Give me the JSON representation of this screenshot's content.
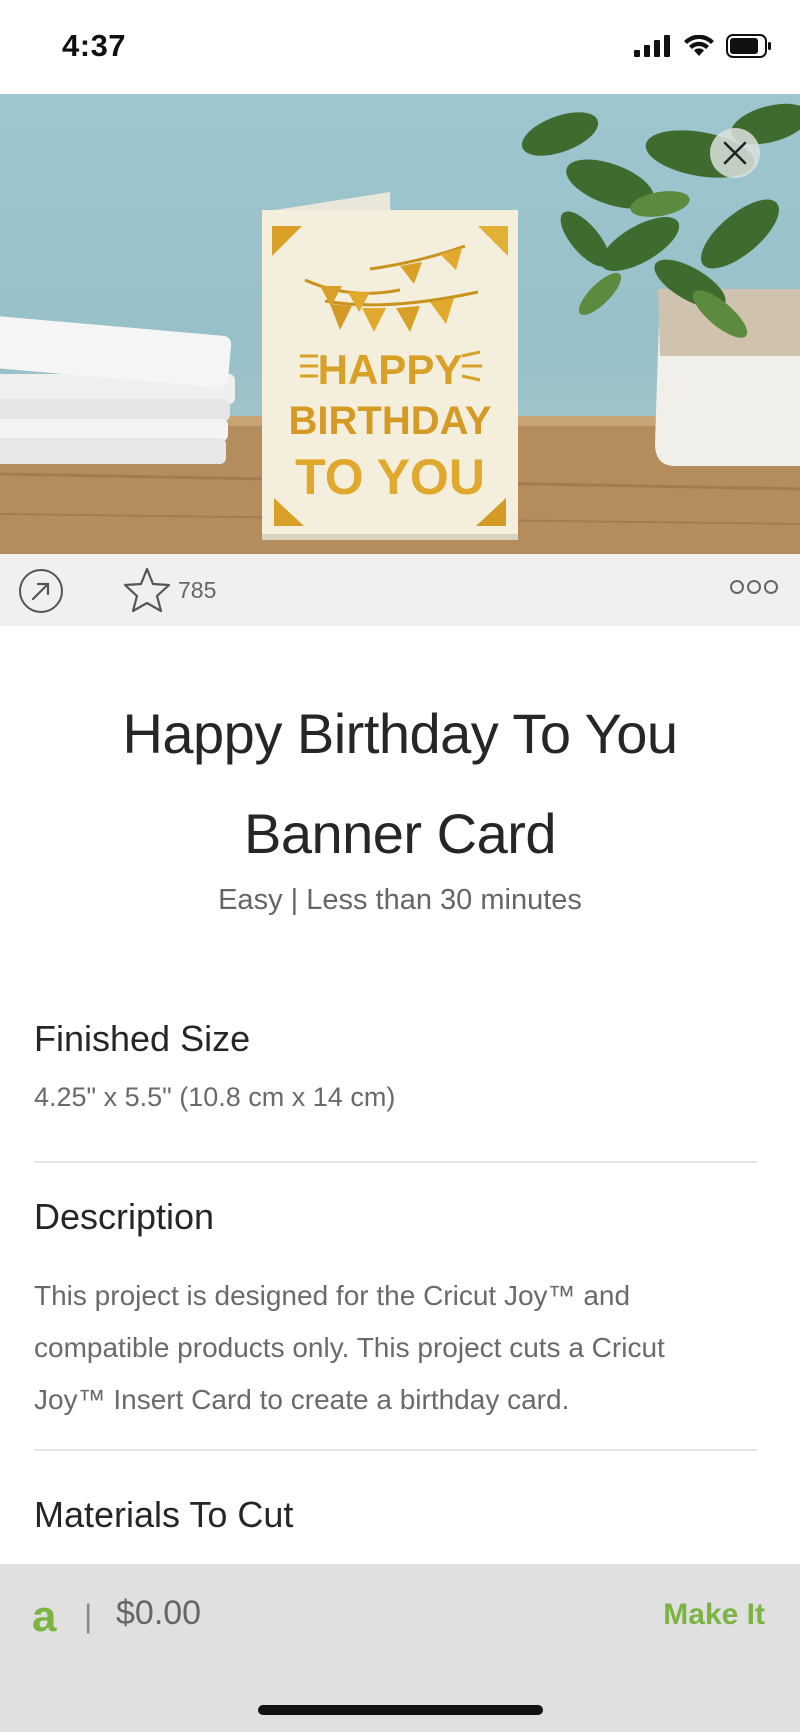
{
  "status": {
    "time": "4:37"
  },
  "project": {
    "favorites_count": "785",
    "title_line1": "Happy Birthday To You",
    "title_line2": "Banner Card",
    "subtitle": "Easy | Less than 30 minutes",
    "card_text": [
      "HAPPY",
      "BIRTHDAY",
      "TO YOU"
    ]
  },
  "sections": {
    "finished_size": {
      "heading": "Finished Size",
      "value": "4.25\" x 5.5\" (10.8 cm x 14 cm)"
    },
    "description": {
      "heading": "Description",
      "text": "This project is designed for the Cricut Joy™ and compatible products only. This project cuts a Cricut Joy™ Insert Card to create a birthday card."
    },
    "materials": {
      "heading": "Materials To Cut"
    }
  },
  "footer": {
    "access_logo": "a",
    "separator": "|",
    "price": "$0.00",
    "make_it_label": "Make It"
  },
  "colors": {
    "accent_green": "#7cb342",
    "card_gold": "#d9a028"
  },
  "icons": [
    "signal-icon",
    "wifi-icon",
    "battery-icon",
    "close-icon",
    "share-icon",
    "star-icon",
    "more-icon"
  ]
}
